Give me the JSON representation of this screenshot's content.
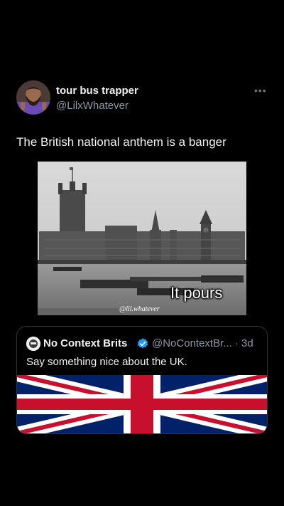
{
  "post": {
    "author": {
      "display_name": "tour bus trapper",
      "handle": "@LilxWhatever",
      "avatar_icon": "profile-photo"
    },
    "more_icon": "ellipsis-icon",
    "text": "The British national anthem is a banger",
    "media": {
      "caption": "It pours",
      "watermark": "@lil.whatever"
    }
  },
  "quote": {
    "author": {
      "display_name": "No Context Brits",
      "handle": "@NoContextBr...",
      "verified": true,
      "avatar_icon": "brits-avatar"
    },
    "separator": "·",
    "time": "3d",
    "text": "Say something nice about the UK.",
    "media_icon": "union-jack-flag"
  },
  "colors": {
    "background": "#000000",
    "secondary_text": "#8b98a5",
    "verified_blue": "#1d9bf0",
    "flag_blue": "#012169",
    "flag_red": "#C8102E"
  }
}
